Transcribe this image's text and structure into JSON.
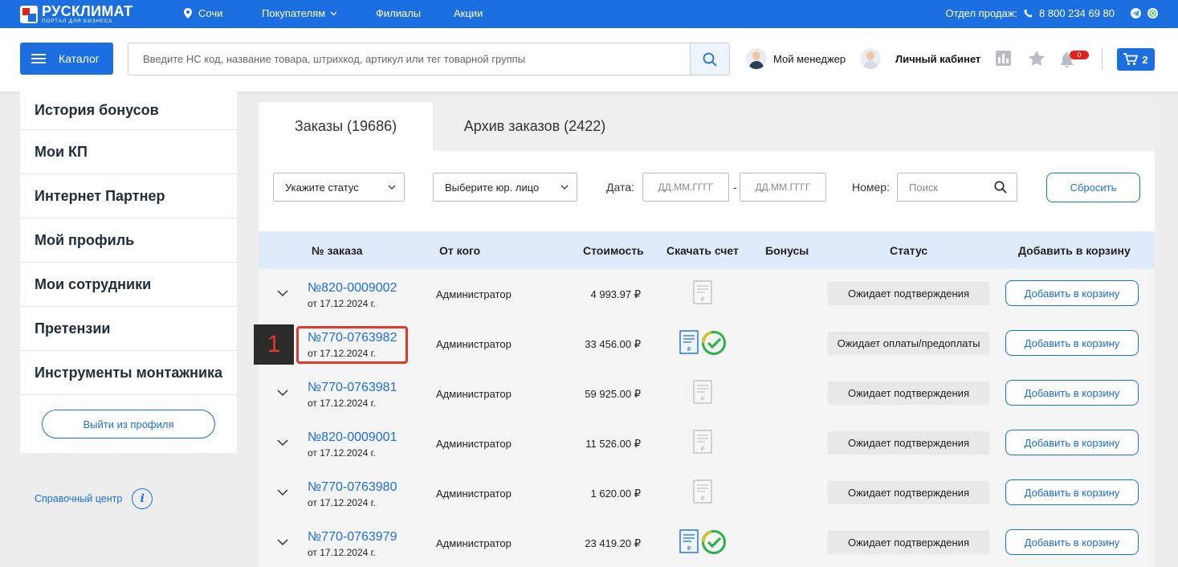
{
  "topbar": {
    "logo_title": "РУСКЛИМАТ",
    "logo_sub": "ПОРТАЛ ДЛЯ БИЗНЕСА",
    "city": "Сочи",
    "nav": [
      "Покупателям",
      "Филиалы",
      "Акции"
    ],
    "sales_label": "Отдел продаж:",
    "phone": "8 800 234 69 80"
  },
  "header": {
    "catalog": "Каталог",
    "search_placeholder": "Введите НС код, название товара, штрихкод, артикул или тег товарной группы",
    "manager": "Мой менеджер",
    "cabinet": "Личный кабинет",
    "notifications": "0",
    "cart_count": "2"
  },
  "sidebar": {
    "items": [
      "История бонусов",
      "Мои КП",
      "Интернет Партнер",
      "Мой профиль",
      "Мои сотрудники",
      "Претензии",
      "Инструменты монтажника"
    ],
    "logout": "Выйти из профиля",
    "help": "Справочный центр"
  },
  "tabs": [
    "Заказы (19686)",
    "Архив заказов (2422)"
  ],
  "filters": {
    "status": "Укажите статус",
    "entity": "Выберите юр. лицо",
    "date_label": "Дата:",
    "date_from": "ДД.ММ.ГГГГ",
    "date_sep": "-",
    "date_to": "ДД.ММ.ГГГГ",
    "number_label": "Номер:",
    "number_placeholder": "Поиск",
    "reset": "Сбросить"
  },
  "columns": [
    "№ заказа",
    "От кого",
    "Стоимость",
    "Скачать счет",
    "Бонусы",
    "Статус",
    "Добавить в корзину"
  ],
  "orders": [
    {
      "number": "№820-0009002",
      "date": "от 17.12.2024 г.",
      "from": "Администратор",
      "cost": "4 993.97 ₽",
      "paid": false,
      "status": "Ожидает подтверждения",
      "action": "Добавить в корзину"
    },
    {
      "number": "№770-0763982",
      "date": "от 17.12.2024 г.",
      "from": "Администратор",
      "cost": "33 456.00 ₽",
      "paid": true,
      "status": "Ожидает оплаты/предоплаты",
      "action": "Добавить в корзину"
    },
    {
      "number": "№770-0763981",
      "date": "от 17.12.2024 г.",
      "from": "Администратор",
      "cost": "59 925.00 ₽",
      "paid": false,
      "status": "Ожидает подтверждения",
      "action": "Добавить в корзину"
    },
    {
      "number": "№820-0009001",
      "date": "от 17.12.2024 г.",
      "from": "Администратор",
      "cost": "11 526.00 ₽",
      "paid": false,
      "status": "Ожидает подтверждения",
      "action": "Добавить в корзину"
    },
    {
      "number": "№770-0763980",
      "date": "от 17.12.2024 г.",
      "from": "Администратор",
      "cost": "1 620.00 ₽",
      "paid": false,
      "status": "Ожидает подтверждения",
      "action": "Добавить в корзину"
    },
    {
      "number": "№770-0763979",
      "date": "от 17.12.2024 г.",
      "from": "Администратор",
      "cost": "23 419.20 ₽",
      "paid": true,
      "status": "Ожидает подтверждения",
      "action": "Добавить в корзину"
    }
  ],
  "annotation": {
    "marker": "1"
  },
  "colors": {
    "brand": "#1b6fe0",
    "highlight": "#e03a2f",
    "paid_check": "#2bb24c"
  }
}
